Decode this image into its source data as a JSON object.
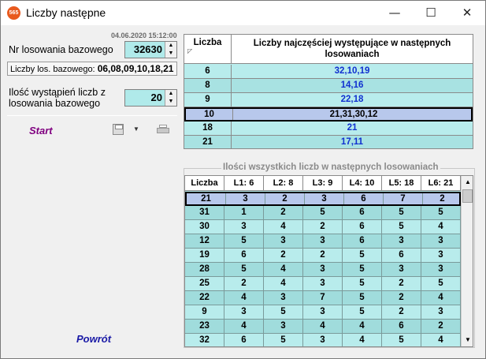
{
  "window": {
    "title": "Liczby następne",
    "icon_text": "565",
    "min": "—",
    "max": "☐",
    "close": "✕"
  },
  "form": {
    "date": "04.06.2020 15:12:00",
    "nr_label": "Nr losowania bazowego",
    "nr_value": "32630",
    "base_label": "Liczby los. bazowego:",
    "base_value": "06,08,09,10,18,21",
    "ilosc_label_1": "Ilość wystąpień liczb z",
    "ilosc_label_2": "losowania bazowego",
    "ilosc_value": "20",
    "start": "Start",
    "powrot": "Powrót"
  },
  "table1": {
    "col1": "Liczba",
    "col2_line1": "Liczby najczęściej występujące w następnych",
    "col2_line2": "losowaniach",
    "rows": [
      [
        "6",
        "32,10,19"
      ],
      [
        "8",
        "14,16"
      ],
      [
        "9",
        "22,18"
      ],
      [
        "10",
        "21,31,30,12"
      ],
      [
        "18",
        "21"
      ],
      [
        "21",
        "17,11"
      ]
    ],
    "selected_index": 3
  },
  "table2": {
    "group_title": "Ilości wszystkich liczb w następnych losowaniach",
    "headers": [
      "Liczba",
      "L1: 6",
      "L2: 8",
      "L3: 9",
      "L4: 10",
      "L5: 18",
      "L6: 21"
    ],
    "rows": [
      [
        "21",
        "3",
        "2",
        "3",
        "6",
        "7",
        "2"
      ],
      [
        "31",
        "1",
        "2",
        "5",
        "6",
        "5",
        "5"
      ],
      [
        "30",
        "3",
        "4",
        "2",
        "6",
        "5",
        "4"
      ],
      [
        "12",
        "5",
        "3",
        "3",
        "6",
        "3",
        "3"
      ],
      [
        "19",
        "6",
        "2",
        "2",
        "5",
        "6",
        "3"
      ],
      [
        "28",
        "5",
        "4",
        "3",
        "5",
        "3",
        "3"
      ],
      [
        "25",
        "2",
        "4",
        "3",
        "5",
        "2",
        "5"
      ],
      [
        "22",
        "4",
        "3",
        "7",
        "5",
        "2",
        "4"
      ],
      [
        "9",
        "3",
        "5",
        "3",
        "5",
        "2",
        "3"
      ],
      [
        "23",
        "4",
        "3",
        "4",
        "4",
        "6",
        "2"
      ],
      [
        "32",
        "6",
        "5",
        "3",
        "4",
        "5",
        "4"
      ]
    ],
    "selected_index": 0
  }
}
